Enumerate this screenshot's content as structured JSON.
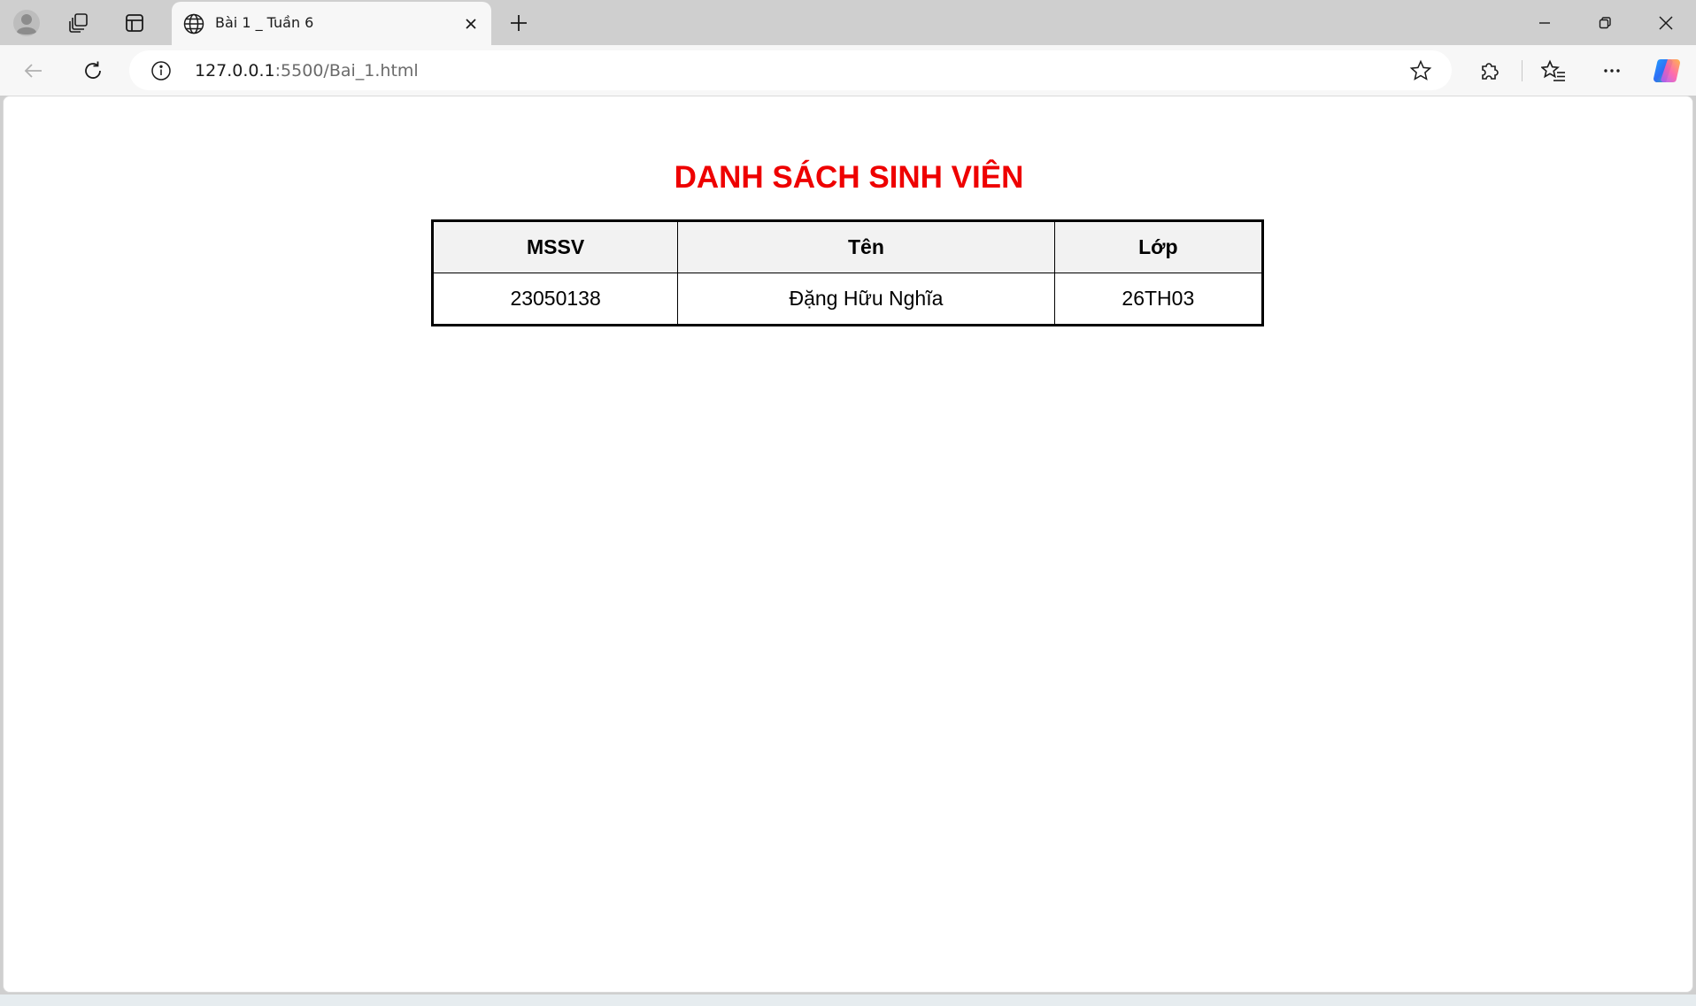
{
  "browser": {
    "tab": {
      "title": "Bài 1 _ Tuần 6"
    },
    "address": {
      "host": "127.0.0.1",
      "rest": ":5500/Bai_1.html"
    }
  },
  "page": {
    "title": "DANH SÁCH SINH VIÊN",
    "table": {
      "headers": [
        "MSSV",
        "Tên",
        "Lớp"
      ],
      "rows": [
        [
          "23050138",
          "Đặng Hữu Nghĩa",
          "26TH03"
        ]
      ]
    }
  },
  "colors": {
    "title_red": "#ee0000",
    "header_bg": "#f2f2f2"
  }
}
